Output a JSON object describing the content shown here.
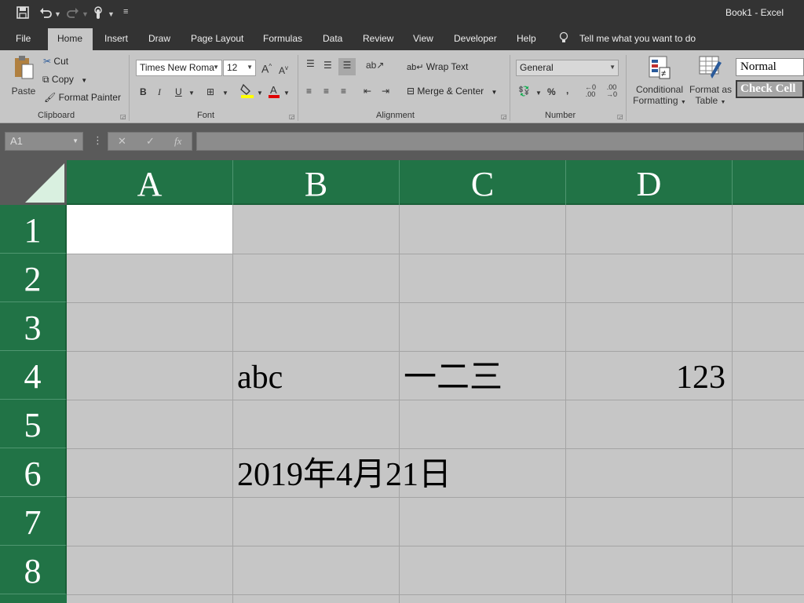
{
  "titlebar": {
    "title": "Book1  -  Excel",
    "save_icon": "save-icon",
    "undo_icon": "undo-icon",
    "redo_icon": "redo-icon",
    "touch_icon": "touch-mode-icon",
    "customize_icon": "customize-qat-icon"
  },
  "tabs": {
    "file": "File",
    "home": "Home",
    "insert": "Insert",
    "draw": "Draw",
    "page_layout": "Page Layout",
    "formulas": "Formulas",
    "data": "Data",
    "review": "Review",
    "view": "View",
    "developer": "Developer",
    "help": "Help",
    "tell_me": "Tell me what you want to do"
  },
  "ribbon": {
    "clipboard": {
      "paste": "Paste",
      "cut": "Cut",
      "copy": "Copy",
      "format_painter": "Format Painter",
      "label": "Clipboard"
    },
    "font": {
      "name": "Times New Roma",
      "size": "12",
      "bold": "B",
      "italic": "I",
      "underline": "U",
      "label": "Font"
    },
    "alignment": {
      "wrap_text": "Wrap Text",
      "merge_center": "Merge & Center",
      "label": "Alignment"
    },
    "number": {
      "format": "General",
      "percent": "%",
      "comma": ",",
      "label": "Number"
    },
    "styles": {
      "conditional_1": "Conditional",
      "conditional_2": "Formatting",
      "format_table_1": "Format as",
      "format_table_2": "Table",
      "normal": "Normal",
      "check_cell": "Check Cell"
    }
  },
  "formula_bar": {
    "name_box": "A1",
    "fx": "fx",
    "value": ""
  },
  "sheet": {
    "columns": [
      "A",
      "B",
      "C",
      "D"
    ],
    "rows": [
      "1",
      "2",
      "3",
      "4",
      "5",
      "6",
      "7",
      "8"
    ],
    "cells": {
      "B4": "abc",
      "C4": "一二三",
      "D4": "123",
      "B6": "2019年4月21日"
    },
    "colors": {
      "header_green": "#217346",
      "grid_bg": "#c6c6c6"
    }
  }
}
